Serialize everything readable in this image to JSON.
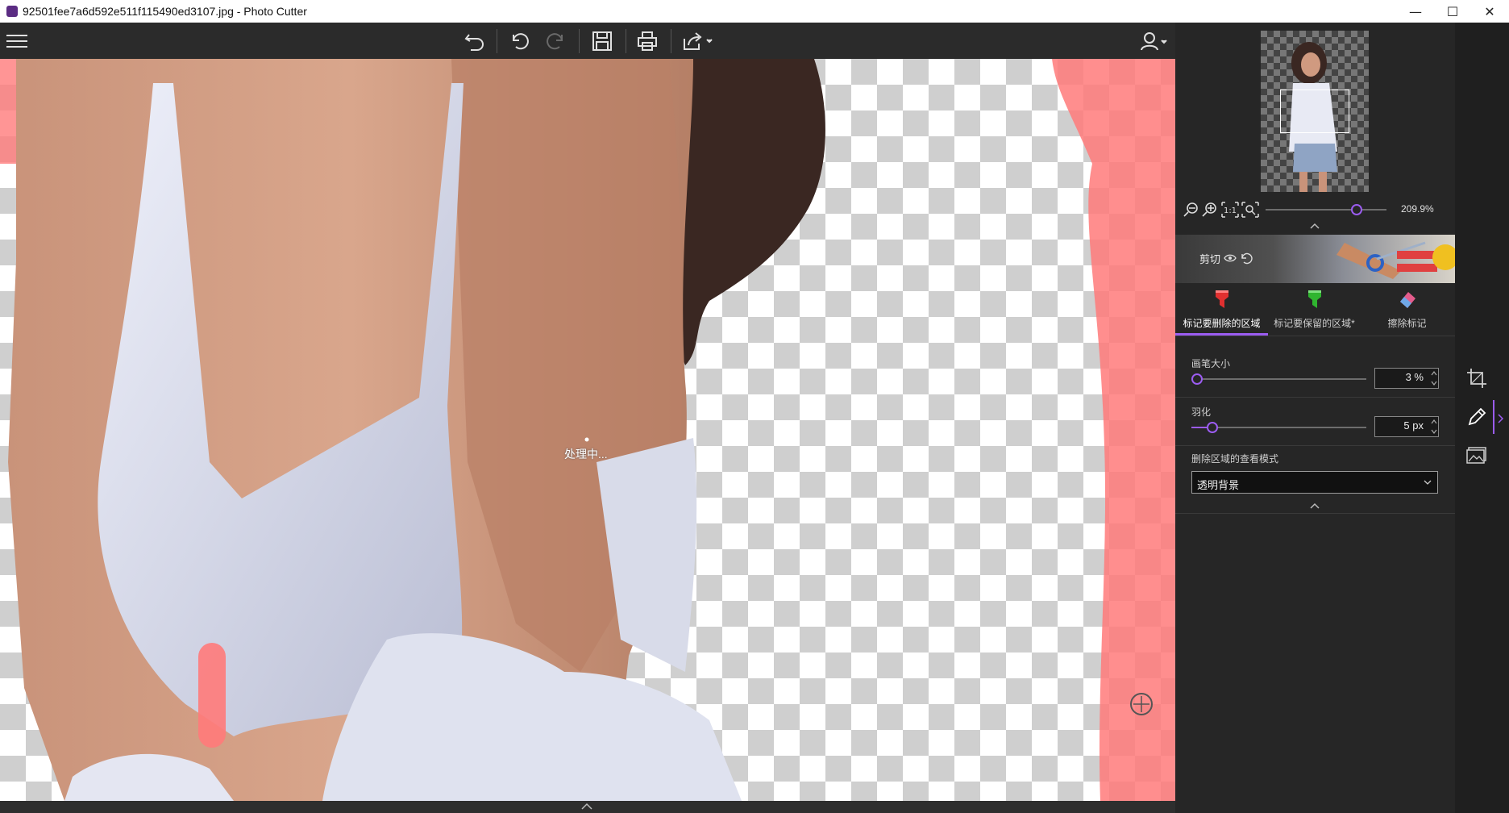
{
  "window": {
    "title": "92501fee7a6d592e511f115490ed3107.jpg - Photo Cutter",
    "controls": {
      "minimize": "—",
      "maximize": "☐",
      "close": "✕"
    }
  },
  "toolbar": {
    "icons": [
      "menu-icon",
      "undo-history-icon",
      "undo-icon",
      "redo-icon",
      "save-icon",
      "print-icon",
      "share-icon",
      "user-icon"
    ]
  },
  "canvas": {
    "status_text": "处理中..."
  },
  "panel": {
    "zoom_value": "209.9%",
    "zoom_level": 0.75,
    "cut_label": "剪切",
    "tabs": [
      {
        "label": "标记要删除的区域",
        "icon": "red-marker-icon",
        "color": "#e03030",
        "active": true
      },
      {
        "label": "标记要保留的区域*",
        "icon": "green-marker-icon",
        "color": "#2fb52f",
        "active": false
      },
      {
        "label": "擦除标记",
        "icon": "eraser-icon",
        "color": "#e45c8c",
        "active": false
      }
    ],
    "brush": {
      "label": "画笔大小",
      "value": "3 %",
      "level": 0.03
    },
    "feather": {
      "label": "羽化",
      "value": "5 px",
      "level": 0.12
    },
    "view_mode": {
      "label": "删除区域的查看模式",
      "selected": "透明背景"
    }
  },
  "colors": {
    "accent": "#9b5cf0",
    "remove_mark": "#ff7a7a"
  }
}
